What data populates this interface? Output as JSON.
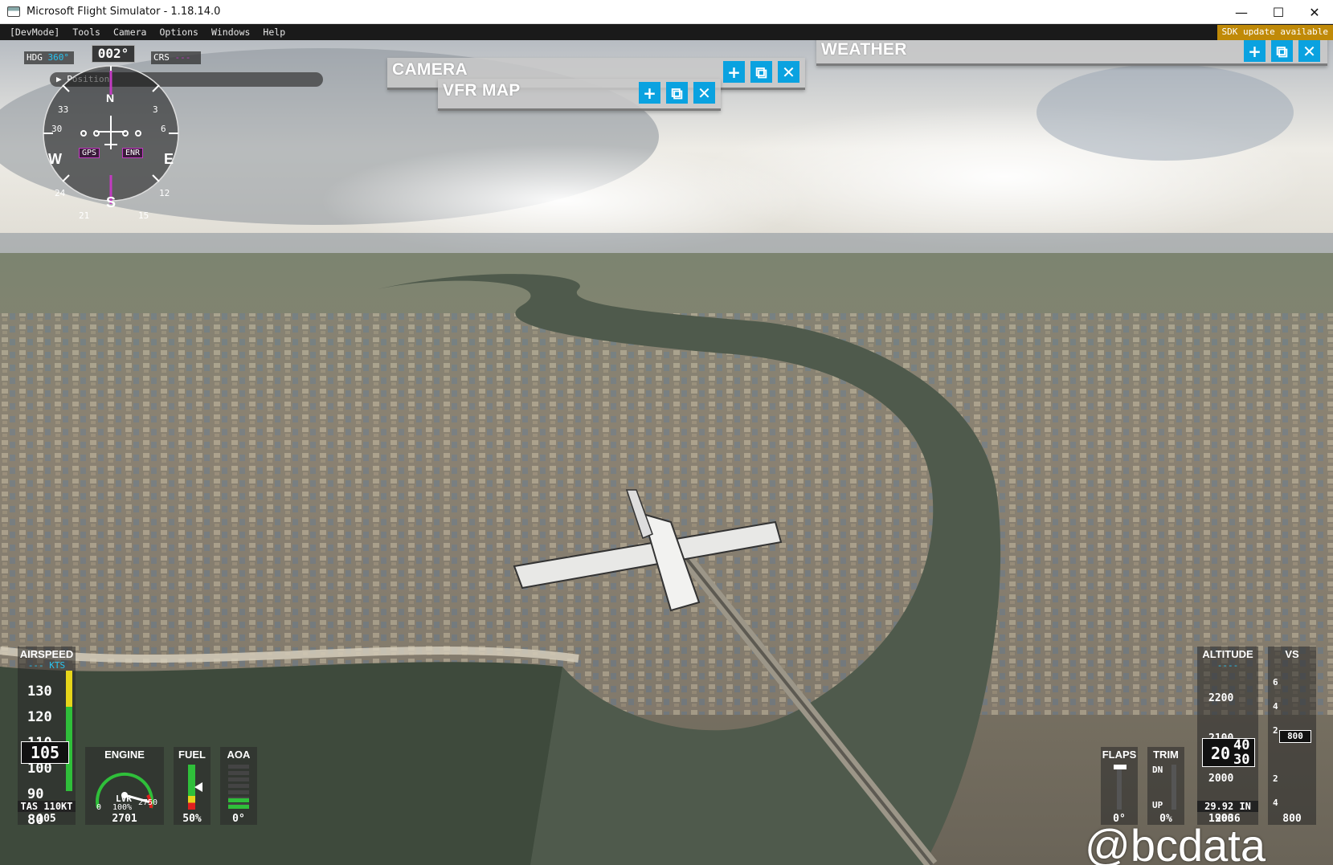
{
  "window": {
    "title": "Microsoft Flight Simulator - 1.18.14.0",
    "minimize": "—",
    "maximize": "☐",
    "close": "✕"
  },
  "devmenu": {
    "items": [
      "[DevMode]",
      "Tools",
      "Camera",
      "Options",
      "Windows",
      "Help"
    ],
    "sdk_notice": "SDK update available"
  },
  "panels": {
    "camera": {
      "title": "CAMERA"
    },
    "vfr_map": {
      "title": "VFR MAP"
    },
    "weather": {
      "title": "WEATHER"
    },
    "buttons": {
      "add": "+",
      "popout": "⧉",
      "close": "✕"
    },
    "accent": "#0aa2e0"
  },
  "compass": {
    "heading_readout": "002°",
    "hdg_label": "HDG",
    "hdg_value": "360°",
    "crs_label": "CRS",
    "crs_value": "---",
    "position_label": "▶ Position",
    "gps_badge": "GPS",
    "enr_badge": "ENR",
    "cardinals": {
      "n": "N",
      "e": "E",
      "s": "S",
      "w": "W"
    },
    "ticks": [
      "3",
      "6",
      "12",
      "15",
      "21",
      "24",
      "30",
      "33"
    ]
  },
  "airspeed": {
    "title": "AIRSPEED",
    "units": "--- KTS",
    "scale": [
      "130",
      "120",
      "110",
      "100",
      "90",
      "80"
    ],
    "current": "105",
    "tas": "TAS 110KT",
    "footer": "105"
  },
  "engine": {
    "title": "ENGINE",
    "min": "0",
    "lvr": "LVR",
    "pct": "100%",
    "max": "2750",
    "footer": "2701",
    "rpm_fraction": 0.98
  },
  "fuel": {
    "title": "FUEL",
    "footer": "50%",
    "level": 0.5
  },
  "aoa": {
    "title": "AOA",
    "footer": "0°"
  },
  "flaps": {
    "title": "FLAPS",
    "footer": "0°"
  },
  "trim": {
    "title": "TRIM",
    "dn": "DN",
    "up": "UP",
    "footer": "0%"
  },
  "altitude": {
    "title": "ALTITUDE",
    "units": "----",
    "scale": [
      "2200",
      "2100",
      "2000",
      "1900"
    ],
    "current_hundreds": "20",
    "current_tens_top": "40",
    "current_tens_bottom": "30",
    "baro": "29.92 IN",
    "footer": "2036"
  },
  "vs": {
    "title": "VS",
    "scale": [
      "6",
      "4",
      "2",
      "2",
      "4",
      "6"
    ],
    "current": "800",
    "footer": "800"
  },
  "watermark": "@bcdata"
}
